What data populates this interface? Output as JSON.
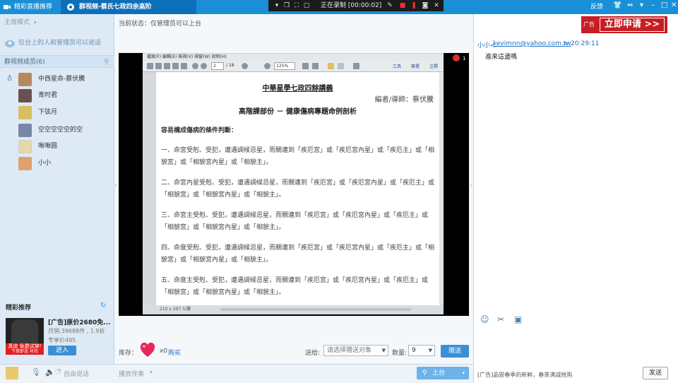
{
  "topbar": {
    "tab1_label": "精彩直播推荐",
    "tab2_label": "群视频-蔡氏七政四余高阶(392814823)",
    "recording_status": "正在录制 [00:00:02]",
    "fanbtn": "反馈"
  },
  "sidebar": {
    "mode_label": "主席模式",
    "mode_hint": "仅台上的人和管理员可以说话",
    "members_header": "群视频成员(6)",
    "members": [
      {
        "name": "中西星命-蔡伏騰",
        "color": "#b88860"
      },
      {
        "name": "青时君",
        "color": "#6b5050"
      },
      {
        "name": "下弦月",
        "color": "#d8c060"
      },
      {
        "name": "空空空空空的空",
        "color": "#7a86a8"
      },
      {
        "name": "啾啾圆",
        "color": "#e8d8a8"
      },
      {
        "name": "小小",
        "color": "#e0a070"
      }
    ],
    "recommend_title": "精彩推荐",
    "ad": {
      "title": "[广告]原价2680免...",
      "sales": "月销:39688件 , 1.9折",
      "price": "专享价495",
      "enter_label": "进入",
      "img_label": "真皮 免费试穿!",
      "img_sub": "下单即送 衬衣"
    }
  },
  "main": {
    "status_text": "当前状态：仅管理员可以上台",
    "pdf": {
      "menu": "檔案(F)    編輯(E)    檢視(V)    視窗(W)    說明(H)",
      "page_box": "2",
      "page_total": "/ 18",
      "zoom": "125%",
      "tool_labels": [
        "工具",
        "簽署",
        "注釋"
      ],
      "title": "中華星學七政四餘講義",
      "author": "編者/導師：蔡伏騰",
      "subtitle": "高階課部份 － 健康傷病專題命例剖析",
      "heading": "容易構成傷病的條件判斷：",
      "paragraphs": [
        "一、命宮受剋、受犯，遭遇調候忌星，而關連到「疾厄宮」或「疾厄宮內星」或「疾厄主」或「相貌宮」或「相貌宮內星」或「相貌主」。",
        "二、命宮內星受剋、受犯，遭遇調候忌星，而關連到「疾厄宮」或「疾厄宮內星」或「疾厄主」或「相貌宮」或「相貌宮內星」或「相貌主」。",
        "三、命宮主受剋、受犯，遭遇調候忌星，而關連到「疾厄宮」或「疾厄宮內星」或「疾厄主」或「相貌宮」或「相貌宮內星」或「相貌主」。",
        "四、命度受剋、受犯，遭遇調候忌星，而關連到「疾厄宮」或「疾厄宮內星」或「疾厄主」或「相貌宮」或「相貌宮內星」或「相貌主」。",
        "五、命度主受剋、受犯，遭遇調候忌星，而關連到「疾厄宮」或「疾厄宮內星」或「疾厄主」或「相貌宮」或「相貌宮內星」或「相貌主」。"
      ],
      "status": "210 x 297 公釐"
    },
    "stage_count": "1",
    "stock_label": "库存：",
    "stock_count": "x0",
    "buy_label": "购买",
    "giveto_label": "送给:",
    "target_placeholder": "请选择赠送对象",
    "qty_label": "数量:",
    "qty_value": "9",
    "give_label": "赠送"
  },
  "bottombar": {
    "free_speak": "自由说话",
    "play_accompaniment": "播放伴奏",
    "stage_button": "上台"
  },
  "chat": {
    "ad_label": "广告",
    "ad_button": "立即申请 >>",
    "sender_name": "小小<",
    "sender_mail": "kevimnn@yahoo.com.tw",
    "sender_close": ">",
    "time": "20:29:11",
    "message": "進來這邊嗎",
    "ad_line": "[广告]品尝春季的新鲜，春茶满减抢购",
    "send_label": "发送"
  },
  "colors": {
    "topbar": "#1a8fd8",
    "accent": "#3a8fd6",
    "ad_red": "#c71d23"
  }
}
